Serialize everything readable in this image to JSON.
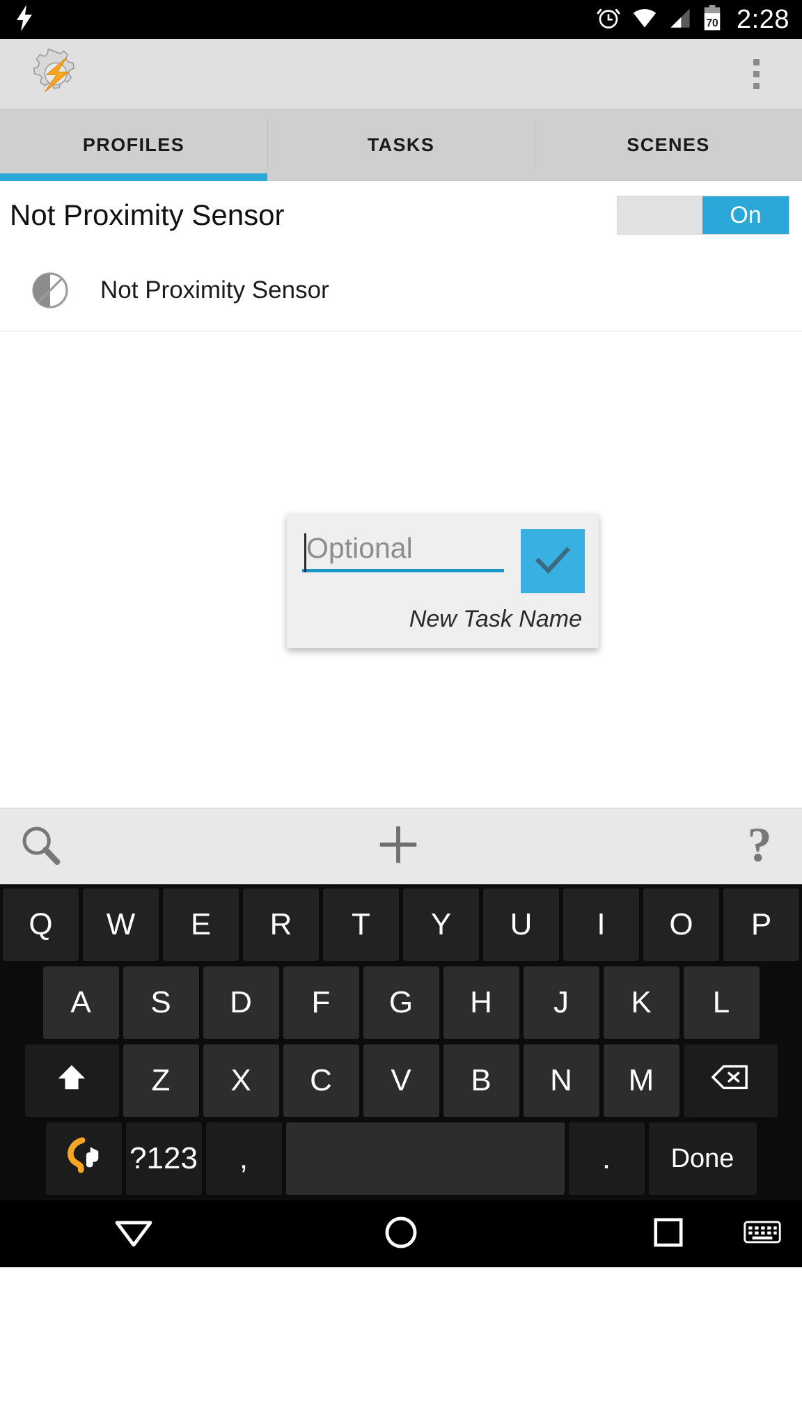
{
  "statusbar": {
    "time": "2:28",
    "battery_level": "70",
    "icons": [
      "flash-icon",
      "alarm-clock-icon",
      "wifi-icon",
      "cell-signal-icon",
      "battery-icon"
    ]
  },
  "appbar": {
    "logo_name": "tasker-logo",
    "overflow_name": "overflow-menu"
  },
  "tabs": {
    "items": [
      {
        "label": "PROFILES",
        "selected": true
      },
      {
        "label": "TASKS",
        "selected": false
      },
      {
        "label": "SCENES",
        "selected": false
      }
    ],
    "indicator_color": "#2ca8d8"
  },
  "profile": {
    "name": "Not Proximity Sensor",
    "toggle_label": "On",
    "toggle_state": "on",
    "toggle_color": "#2ca8d8",
    "context": {
      "label": "Not Proximity Sensor",
      "icon": "state-invert-icon"
    }
  },
  "dialog": {
    "input_value": "",
    "input_placeholder": "Optional",
    "confirm_label": "check-icon",
    "caption": "New Task Name",
    "accent_color": "#39b0e2",
    "underline_color": "#1b96c4"
  },
  "actionbar": {
    "buttons": [
      {
        "name": "search-icon",
        "label": ""
      },
      {
        "name": "add-icon",
        "label": ""
      },
      {
        "name": "help-icon",
        "label": ""
      }
    ]
  },
  "keyboard": {
    "row1": [
      "Q",
      "W",
      "E",
      "R",
      "T",
      "Y",
      "U",
      "I",
      "O",
      "P"
    ],
    "row2": [
      "A",
      "S",
      "D",
      "F",
      "G",
      "H",
      "J",
      "K",
      "L"
    ],
    "row3": [
      "Z",
      "X",
      "C",
      "V",
      "B",
      "N",
      "M"
    ],
    "shift_label": "shift-icon",
    "backspace_label": "backspace-icon",
    "tasker_key_label": "tasker-key-icon",
    "symbols_label": "?123",
    "comma_label": ",",
    "space_label": "",
    "period_label": ".",
    "done_label": "Done"
  },
  "navbar": {
    "back_label": "back-triangle-icon",
    "home_label": "home-circle-icon",
    "recents_label": "recents-square-icon",
    "keyboard_label": "keyboard-switch-icon"
  }
}
